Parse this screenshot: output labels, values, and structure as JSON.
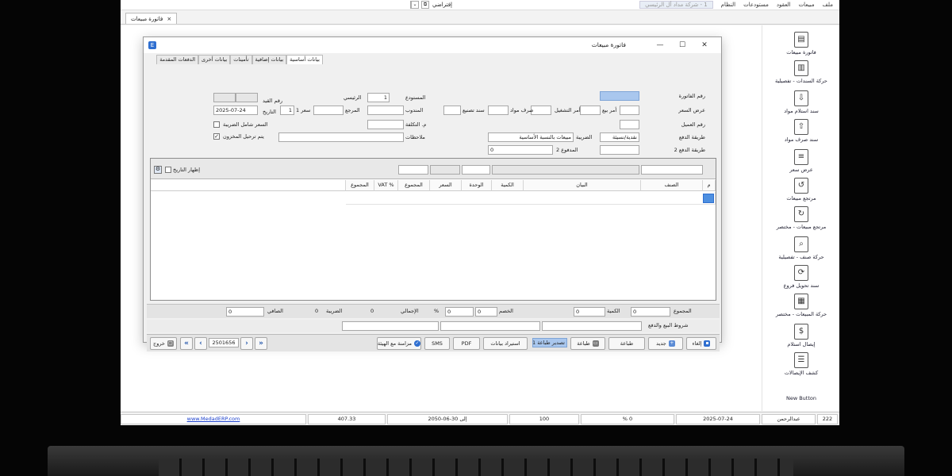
{
  "menubar": {
    "items": [
      "ملف",
      "مبيعات",
      "العقود",
      "مستودعات",
      "النظام"
    ],
    "company": "1 - شركة مداد أل الرئيسي",
    "toolbar_label": "إفتراضي"
  },
  "doc_tab": {
    "label": "فاتورة مبيعات",
    "close": "×"
  },
  "dialog": {
    "title": "فاتورة مبيعات",
    "controls": {
      "min": "—",
      "max": "☐",
      "close": "✕"
    },
    "app_icon": "E",
    "tabs": [
      "بيانات أساسية",
      "بيانات إضافية",
      "تأمينات",
      "بيانات أخرى",
      "الدفعات المقدمة"
    ],
    "labels": {
      "invoice_no": "رقم الفاتورة",
      "quote_offer": "عرض السعر",
      "supply_order": "أمر بيع",
      "work_order": "أمر التشغيل",
      "material_disbursement": "صرف مواد",
      "manufacture_voucher": "سند تصنيع",
      "customer_no": "رقم العميل",
      "payment_method": "طريقة الدفع",
      "tax": "الضريبة",
      "payment_method_2": "طريقة الدفع 2",
      "paid_2": "المدفوع 2",
      "warehouse": "المستودع",
      "delegate": "المندوب",
      "reference": "المرجع",
      "rate": "سعر 1",
      "cost_center": "م. التكلفة",
      "notes": "ملاحظات",
      "date_label": "رقم القيد",
      "date_field_label": "التاريخ",
      "price_incl_tax": "السعر شامل الضريبة",
      "auto_post": "يتم ترحيل المخزون"
    },
    "values": {
      "warehouse": "1",
      "main_warehouse": "الرئيسي",
      "rate": "1",
      "date": "2025-07-24",
      "payment_method": "نقدية/نسيئة",
      "tax": "مبيعات بالنسبة الأساسية",
      "paid_2": "0"
    },
    "grid": {
      "show_date_label": "إظهار التاريخ",
      "columns": [
        "م",
        "الصنف",
        "البيان",
        "الكمية",
        "الوحدة",
        "السعر",
        "المجموع",
        "% VAT",
        "المجموع"
      ]
    },
    "totals": {
      "total_label": "المجموع",
      "total": "0",
      "qty_label": "الكمية",
      "qty": "0",
      "discount_label": "الخصم",
      "discount": "0",
      "discount_pct": "0",
      "pct_sign": "%",
      "gross_label": "الإجمالي",
      "gross": "0",
      "tax_label": "الضريبة",
      "tax": "0",
      "net_label": "الصافي",
      "net": "0"
    },
    "terms_label": "شروط البيع والدفع",
    "actions": {
      "new_label": "إلغاء",
      "new2_label": "جديد",
      "print_label": "طباعة",
      "print2_label": "طباعة",
      "print_select": "تصدير طباعة 1",
      "import_label": "استيراد بيانات",
      "pdf_label": "PDF",
      "sms_label": "SMS",
      "sync_label": "مزامنة مع الهيئة",
      "record_no": "2501656",
      "exit_label": "خروج"
    }
  },
  "sidebar": {
    "items": [
      {
        "label": "فاتورة مبيعات",
        "icon": "document-icon",
        "glyph": "▤"
      },
      {
        "label": "حركة السندات - تفصيلية",
        "icon": "report-icon",
        "glyph": "▥"
      },
      {
        "label": "سند استلام مواد",
        "icon": "inbox-in-icon",
        "glyph": "⇩"
      },
      {
        "label": "سند صرف مواد",
        "icon": "inbox-out-icon",
        "glyph": "⇧"
      },
      {
        "label": "عرض سعر",
        "icon": "quote-icon",
        "glyph": "≡"
      },
      {
        "label": "مرتجع مبيعات",
        "icon": "return-icon",
        "glyph": "↺"
      },
      {
        "label": "مرتجع مبيعات - مختصر",
        "icon": "return-short-icon",
        "glyph": "↻"
      },
      {
        "label": "حركة صنف - تفصيلية",
        "icon": "item-movement-icon",
        "glyph": "⌕"
      },
      {
        "label": "سند تحويل فروع",
        "icon": "transfer-icon",
        "glyph": "⟳"
      },
      {
        "label": "حركة المبيعات - مختصر",
        "icon": "sales-movement-icon",
        "glyph": "▦"
      },
      {
        "label": "إيصال استلام",
        "icon": "receipt-icon",
        "glyph": "$"
      },
      {
        "label": "كشف الإيصالات",
        "icon": "receipts-list-icon",
        "glyph": "☰"
      }
    ],
    "new_button": "New Button"
  },
  "statusbar": {
    "user_id": "222",
    "user_name": "عبدالرحمن",
    "date": "2025-07-24",
    "percent": "% 0",
    "value_100": "100",
    "expiry_label": "إلى",
    "expiry": "30-06-2050",
    "amount": "407.33",
    "website": "www.MedadERP.com"
  }
}
